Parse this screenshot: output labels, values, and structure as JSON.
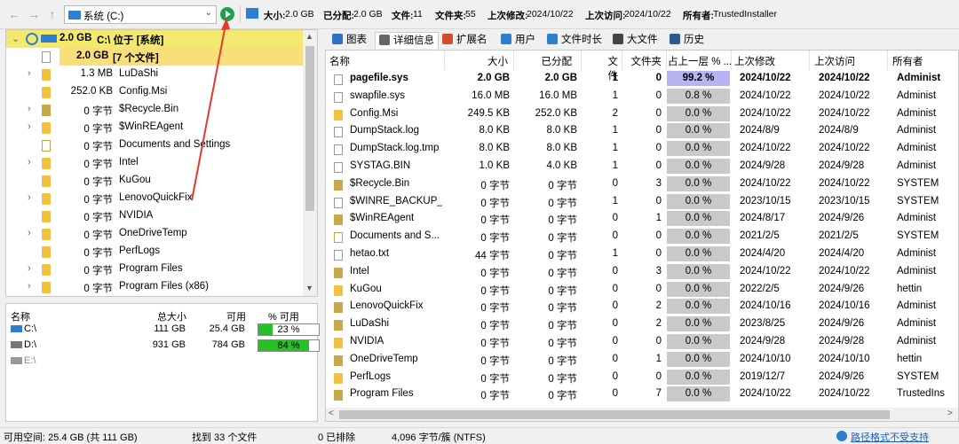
{
  "toolbar": {
    "drive": "系统 (C:)",
    "size_label": "大小:",
    "size_value": "2.0 GB",
    "alloc_label": "已分配:",
    "alloc_value": "2.0 GB",
    "files_label": "文件:",
    "files_value": "11",
    "folders_label": "文件夹:",
    "folders_value": "55",
    "modified_label": "上次修改:",
    "modified_value": "2024/10/22",
    "accessed_label": "上次访问:",
    "accessed_value": "2024/10/22",
    "owner_label": "所有者:",
    "owner_value": "TrustedInstaller"
  },
  "tree": {
    "root": {
      "size": "2.0 GB",
      "name": "C:\\ 位于 [系统]"
    },
    "files_row": {
      "size": "2.0 GB",
      "name": "[7 个文件]"
    },
    "items": [
      {
        "size": "1.3 MB",
        "name": "LuDaShi",
        "expand": true,
        "icon": "folder"
      },
      {
        "size": "252.0 KB",
        "name": "Config.Msi",
        "expand": false,
        "icon": "folder"
      },
      {
        "size": "0 字节",
        "name": "$Recycle.Bin",
        "expand": true,
        "icon": "recycle"
      },
      {
        "size": "0 字节",
        "name": "$WinREAgent",
        "expand": true,
        "icon": "folder"
      },
      {
        "size": "0 字节",
        "name": "Documents and Settings",
        "expand": false,
        "icon": "link"
      },
      {
        "size": "0 字节",
        "name": "Intel",
        "expand": true,
        "icon": "folder"
      },
      {
        "size": "0 字节",
        "name": "KuGou",
        "expand": false,
        "icon": "folder"
      },
      {
        "size": "0 字节",
        "name": "LenovoQuickFix",
        "expand": true,
        "icon": "folder"
      },
      {
        "size": "0 字节",
        "name": "NVIDIA",
        "expand": false,
        "icon": "folder"
      },
      {
        "size": "0 字节",
        "name": "OneDriveTemp",
        "expand": true,
        "icon": "folder"
      },
      {
        "size": "0 字节",
        "name": "PerfLogs",
        "expand": false,
        "icon": "folder"
      },
      {
        "size": "0 字节",
        "name": "Program Files",
        "expand": true,
        "icon": "folder"
      },
      {
        "size": "0 字节",
        "name": "Program Files (x86)",
        "expand": true,
        "icon": "folder"
      }
    ]
  },
  "drives": {
    "headers": {
      "name": "名称",
      "total": "总大小",
      "free": "可用",
      "pct": "% 可用"
    },
    "rows": [
      {
        "name": "C:\\",
        "total": "111 GB",
        "free": "25.4 GB",
        "pct": "23 %",
        "fill": 0.23
      },
      {
        "name": "D:\\",
        "total": "931 GB",
        "free": "784 GB",
        "pct": "84 %",
        "fill": 0.84
      },
      {
        "name": "E:\\",
        "total": "",
        "free": "",
        "pct": "",
        "fill": 0
      }
    ]
  },
  "tabs": [
    "图表",
    "详细信息",
    "扩展名",
    "用户",
    "文件时长",
    "大文件",
    "历史"
  ],
  "grid": {
    "headers": {
      "name": "名称",
      "size": "大小",
      "alloc": "已分配",
      "files": "文件",
      "folders": "文件夹",
      "pct": "占上一层 % ...",
      "modified": "上次修改",
      "accessed": "上次访问",
      "owner": "所有者"
    },
    "rows": [
      {
        "name": "pagefile.sys",
        "size": "2.0 GB",
        "alloc": "2.0 GB",
        "files": "1",
        "folders": "0",
        "pct": "99.2 %",
        "modified": "2024/10/22",
        "accessed": "2024/10/22",
        "owner": "Administ",
        "icon": "file",
        "bold": true
      },
      {
        "name": "swapfile.sys",
        "size": "16.0 MB",
        "alloc": "16.0 MB",
        "files": "1",
        "folders": "0",
        "pct": "0.8 %",
        "modified": "2024/10/22",
        "accessed": "2024/10/22",
        "owner": "Administ",
        "icon": "file"
      },
      {
        "name": "Config.Msi",
        "size": "249.5 KB",
        "alloc": "252.0 KB",
        "files": "2",
        "folders": "0",
        "pct": "0.0 %",
        "modified": "2024/10/22",
        "accessed": "2024/10/22",
        "owner": "Administ",
        "icon": "folder"
      },
      {
        "name": "DumpStack.log",
        "size": "8.0 KB",
        "alloc": "8.0 KB",
        "files": "1",
        "folders": "0",
        "pct": "0.0 %",
        "modified": "2024/8/9",
        "accessed": "2024/8/9",
        "owner": "Administ",
        "icon": "file"
      },
      {
        "name": "DumpStack.log.tmp",
        "size": "8.0 KB",
        "alloc": "8.0 KB",
        "files": "1",
        "folders": "0",
        "pct": "0.0 %",
        "modified": "2024/10/22",
        "accessed": "2024/10/22",
        "owner": "Administ",
        "icon": "file"
      },
      {
        "name": "SYSTAG.BIN",
        "size": "1.0 KB",
        "alloc": "4.0 KB",
        "files": "1",
        "folders": "0",
        "pct": "0.0 %",
        "modified": "2024/9/28",
        "accessed": "2024/9/28",
        "owner": "Administ",
        "icon": "file"
      },
      {
        "name": "$Recycle.Bin",
        "size": "0 字节",
        "alloc": "0 字节",
        "files": "0",
        "folders": "3",
        "pct": "0.0 %",
        "modified": "2024/10/22",
        "accessed": "2024/10/22",
        "owner": "SYSTEM",
        "icon": "recycle"
      },
      {
        "name": "$WINRE_BACKUP_...",
        "size": "0 字节",
        "alloc": "0 字节",
        "files": "1",
        "folders": "0",
        "pct": "0.0 %",
        "modified": "2023/10/15",
        "accessed": "2023/10/15",
        "owner": "SYSTEM",
        "icon": "file"
      },
      {
        "name": "$WinREAgent",
        "size": "0 字节",
        "alloc": "0 字节",
        "files": "0",
        "folders": "1",
        "pct": "0.0 %",
        "modified": "2024/8/17",
        "accessed": "2024/9/26",
        "owner": "Administ",
        "icon": "recycle"
      },
      {
        "name": "Documents and S...",
        "size": "0 字节",
        "alloc": "0 字节",
        "files": "0",
        "folders": "0",
        "pct": "0.0 %",
        "modified": "2021/2/5",
        "accessed": "2021/2/5",
        "owner": "SYSTEM",
        "icon": "link"
      },
      {
        "name": "hetao.txt",
        "size": "44 字节",
        "alloc": "0 字节",
        "files": "1",
        "folders": "0",
        "pct": "0.0 %",
        "modified": "2024/4/20",
        "accessed": "2024/4/20",
        "owner": "Administ",
        "icon": "file"
      },
      {
        "name": "Intel",
        "size": "0 字节",
        "alloc": "0 字节",
        "files": "0",
        "folders": "3",
        "pct": "0.0 %",
        "modified": "2024/10/22",
        "accessed": "2024/10/22",
        "owner": "Administ",
        "icon": "recycle"
      },
      {
        "name": "KuGou",
        "size": "0 字节",
        "alloc": "0 字节",
        "files": "0",
        "folders": "0",
        "pct": "0.0 %",
        "modified": "2022/2/5",
        "accessed": "2024/9/26",
        "owner": "hettin",
        "icon": "folder"
      },
      {
        "name": "LenovoQuickFix",
        "size": "0 字节",
        "alloc": "0 字节",
        "files": "0",
        "folders": "2",
        "pct": "0.0 %",
        "modified": "2024/10/16",
        "accessed": "2024/10/16",
        "owner": "Administ",
        "icon": "recycle"
      },
      {
        "name": "LuDaShi",
        "size": "0 字节",
        "alloc": "0 字节",
        "files": "0",
        "folders": "2",
        "pct": "0.0 %",
        "modified": "2023/8/25",
        "accessed": "2024/9/26",
        "owner": "Administ",
        "icon": "recycle"
      },
      {
        "name": "NVIDIA",
        "size": "0 字节",
        "alloc": "0 字节",
        "files": "0",
        "folders": "0",
        "pct": "0.0 %",
        "modified": "2024/9/28",
        "accessed": "2024/9/28",
        "owner": "Administ",
        "icon": "folder"
      },
      {
        "name": "OneDriveTemp",
        "size": "0 字节",
        "alloc": "0 字节",
        "files": "0",
        "folders": "1",
        "pct": "0.0 %",
        "modified": "2024/10/10",
        "accessed": "2024/10/10",
        "owner": "hettin",
        "icon": "recycle"
      },
      {
        "name": "PerfLogs",
        "size": "0 字节",
        "alloc": "0 字节",
        "files": "0",
        "folders": "0",
        "pct": "0.0 %",
        "modified": "2019/12/7",
        "accessed": "2024/9/26",
        "owner": "SYSTEM",
        "icon": "folder"
      },
      {
        "name": "Program Files",
        "size": "0 字节",
        "alloc": "0 字节",
        "files": "0",
        "folders": "7",
        "pct": "0.0 %",
        "modified": "2024/10/22",
        "accessed": "2024/10/22",
        "owner": "TrustedIns",
        "icon": "recycle"
      }
    ]
  },
  "status": {
    "free_space": "可用空间: 25.4 GB  (共 111 GB)",
    "found": "找到 33 个文件",
    "excluded": "0 已排除",
    "cluster": "4,096 字节/簇 (NTFS)",
    "path_warning": "路径格式不受支持"
  },
  "colors": {
    "accent_bar": "#27c027",
    "root_highlight": "#f2e96e",
    "selected_pct": "#b9b3f2",
    "annotation_arrow": "#e53a2d"
  }
}
